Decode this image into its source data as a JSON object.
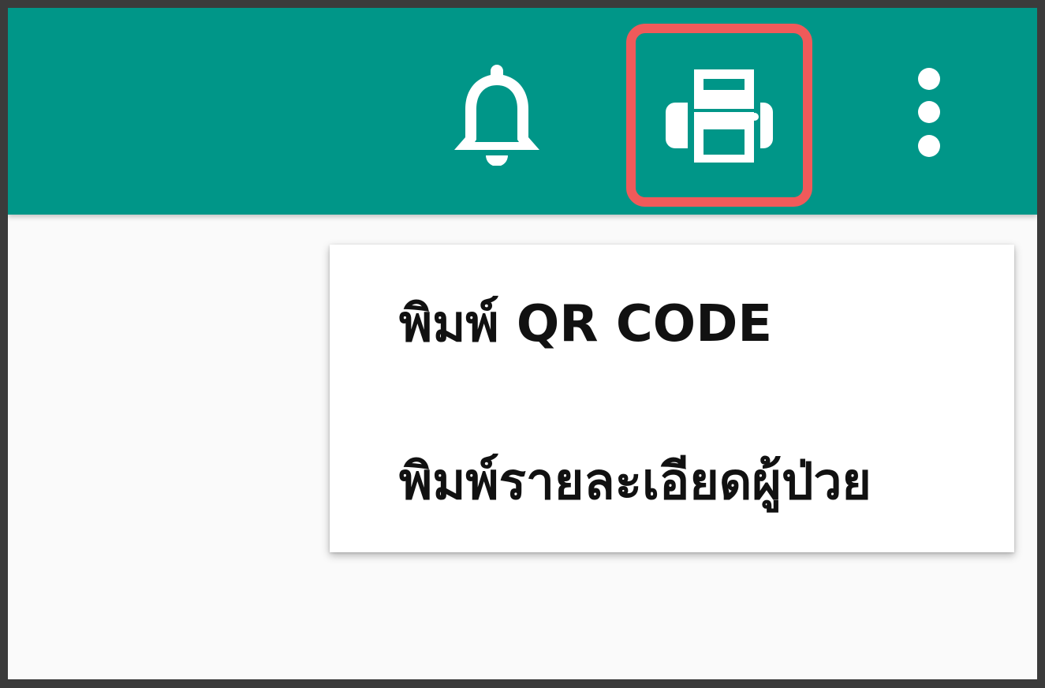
{
  "toolbar": {
    "background_color": "#009688",
    "highlight_color": "#f05a5a",
    "icons": {
      "notifications": "bell-icon",
      "print": "printer-icon",
      "more": "more-vertical-icon"
    }
  },
  "print_menu": {
    "items": [
      {
        "label": "พิมพ์ QR CODE"
      },
      {
        "label": "พิมพ์รายละเอียดผู้ป่วย"
      }
    ]
  }
}
